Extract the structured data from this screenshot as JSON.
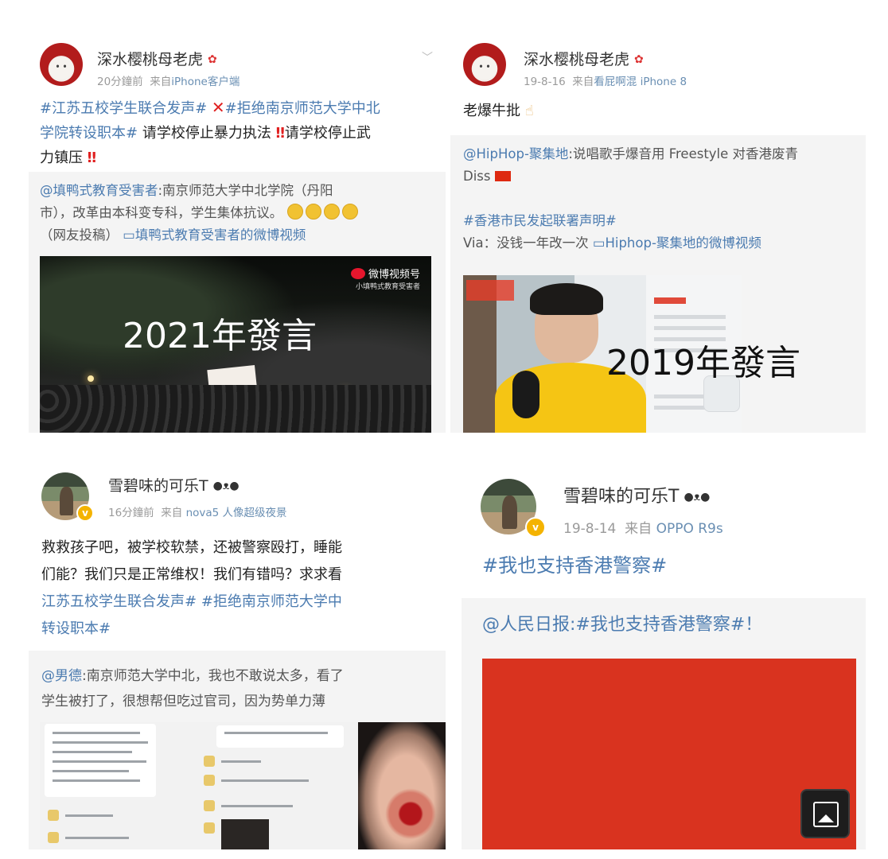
{
  "posts": [
    {
      "user": "深水樱桃母老虎",
      "time": "20分鐘前",
      "source_prefix": "来自",
      "source": "iPhone客户端",
      "lines": [
        [
          "#江苏五校学生联合发声#",
          "#拒绝南京师范大学中北"
        ],
        [
          "学院转设职本#",
          "请学校停止暴力执法",
          "请学校停止武"
        ],
        [
          "力镇压"
        ]
      ],
      "quote_lines": [
        [
          "@填鸭式教育受害者",
          ":南京师范大学中北学院（丹阳"
        ],
        [
          "市），改革由本科变专科，学生集体抗议。"
        ],
        [
          "（网友投稿）",
          "填鸭式教育受害者的微博视频"
        ]
      ],
      "video_label": "2021年發言",
      "video_logo": "微博视频号",
      "video_logo_sub": "小填鸭式教育受害者"
    },
    {
      "user": "深水樱桃母老虎",
      "time": "19-8-16",
      "source_prefix": "来自",
      "source": "看屁啊混 iPhone 8",
      "text": "老爆牛批",
      "quote_lines": [
        [
          "@HipHop-聚集地",
          ":说唱歌手爆音用 Freestyle 对香港废青"
        ],
        [
          "Diss"
        ],
        [
          ""
        ],
        [
          "#香港市民发起联署声明#"
        ],
        [
          "Via：没钱一年改一次",
          "Hiphop-聚集地的微博视频"
        ]
      ],
      "video_label": "2019年發言"
    },
    {
      "user": "雪碧味的可乐T",
      "time": "16分鐘前",
      "source_prefix": "来自",
      "source": "nova5 人像超级夜景",
      "lines": [
        [
          "救救孩子吧，被学校软禁，还被警察殴打，睡能"
        ],
        [
          "们能？我们只是正常维权！我们有错吗？求求看"
        ],
        [
          "江苏五校学生联合发声#",
          "#拒绝南京师范大学中"
        ],
        [
          "转设职本#"
        ]
      ],
      "quote_lines": [
        [
          "@男德",
          ":南京师范大学中北，我也不敢说太多，看了"
        ],
        [
          "学生被打了，很想帮但吃过官司，因为势单力薄"
        ]
      ]
    },
    {
      "user": "雪碧味的可乐T",
      "time": "19-8-14",
      "source_prefix": "来自",
      "source": "OPPO R9s",
      "text": "#我也支持香港警察#",
      "quote": [
        "@人民日报",
        ":#我也支持香港警察#！"
      ]
    }
  ]
}
